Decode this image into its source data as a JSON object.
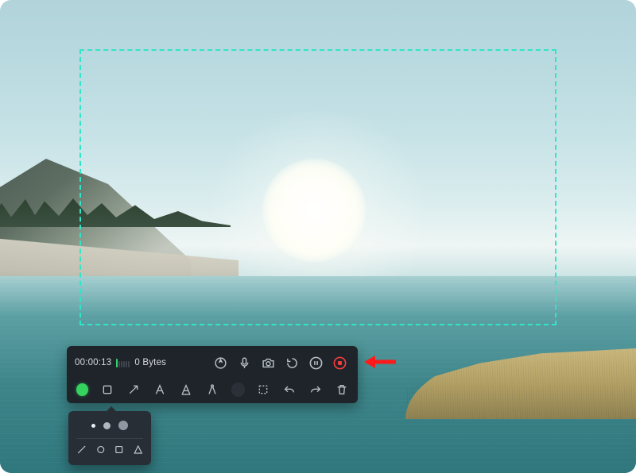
{
  "recorder": {
    "timer": "00:00:13",
    "file_size": "0 Bytes",
    "controls": {
      "cursor_highlight": "cursor-highlight",
      "microphone": "microphone",
      "camera_snapshot": "camera",
      "restart": "restart",
      "pause": "pause",
      "stop": "stop"
    },
    "annotation_tools": {
      "color": "green",
      "rectangle": "rectangle",
      "arrow": "arrow",
      "text": "text",
      "highlighter": "highlighter",
      "caliper": "compass",
      "eraser": "brush-color",
      "marquee": "marquee",
      "undo": "undo",
      "redo": "redo",
      "delete": "delete"
    }
  },
  "popover": {
    "sizes": [
      "small",
      "medium",
      "large"
    ],
    "shapes": [
      "line",
      "circle",
      "square",
      "triangle"
    ]
  },
  "callout": {
    "target": "stop-button"
  }
}
